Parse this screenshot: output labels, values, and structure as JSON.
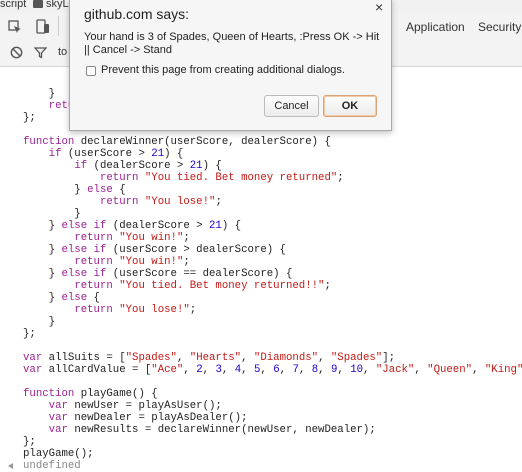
{
  "top": {
    "breadcrumb_left": "script",
    "breadcrumb_right": "skyLa"
  },
  "tabs": {
    "application": "Application",
    "security": "Security"
  },
  "filter": {
    "partial_label": "to"
  },
  "dialog": {
    "title": "github.com says:",
    "message": "Your hand is 3 of Spades, Queen of Hearts, :Press OK -> Hit || Cancel -> Stand",
    "checkbox_label": "Prevent this page from creating additional dialogs.",
    "cancel_label": "Cancel",
    "ok_label": "OK",
    "close_glyph": "×"
  },
  "console": {
    "lines": [
      [
        {
          "t": "    }",
          "c": "plain"
        }
      ],
      [
        {
          "t": "    retu",
          "c": "kw"
        }
      ],
      [
        {
          "t": "};",
          "c": "plain"
        }
      ],
      [
        {
          "t": "",
          "c": "plain"
        }
      ],
      [
        {
          "t": "function",
          "c": "kw"
        },
        {
          "t": " declareWinner(userScore, dealerScore) {",
          "c": "plain"
        }
      ],
      [
        {
          "t": "    ",
          "c": "plain"
        },
        {
          "t": "if",
          "c": "kw"
        },
        {
          "t": " (userScore > ",
          "c": "plain"
        },
        {
          "t": "21",
          "c": "num"
        },
        {
          "t": ") {",
          "c": "plain"
        }
      ],
      [
        {
          "t": "        ",
          "c": "plain"
        },
        {
          "t": "if",
          "c": "kw"
        },
        {
          "t": " (dealerScore > ",
          "c": "plain"
        },
        {
          "t": "21",
          "c": "num"
        },
        {
          "t": ") {",
          "c": "plain"
        }
      ],
      [
        {
          "t": "            ",
          "c": "plain"
        },
        {
          "t": "return",
          "c": "kw"
        },
        {
          "t": " ",
          "c": "plain"
        },
        {
          "t": "\"You tied. Bet money returned\"",
          "c": "str"
        },
        {
          "t": ";",
          "c": "plain"
        }
      ],
      [
        {
          "t": "        } ",
          "c": "plain"
        },
        {
          "t": "else",
          "c": "kw"
        },
        {
          "t": " {",
          "c": "plain"
        }
      ],
      [
        {
          "t": "            ",
          "c": "plain"
        },
        {
          "t": "return",
          "c": "kw"
        },
        {
          "t": " ",
          "c": "plain"
        },
        {
          "t": "\"You lose!\"",
          "c": "str"
        },
        {
          "t": ";",
          "c": "plain"
        }
      ],
      [
        {
          "t": "        }",
          "c": "plain"
        }
      ],
      [
        {
          "t": "    } ",
          "c": "plain"
        },
        {
          "t": "else if",
          "c": "kw"
        },
        {
          "t": " (dealerScore > ",
          "c": "plain"
        },
        {
          "t": "21",
          "c": "num"
        },
        {
          "t": ") {",
          "c": "plain"
        }
      ],
      [
        {
          "t": "        ",
          "c": "plain"
        },
        {
          "t": "return",
          "c": "kw"
        },
        {
          "t": " ",
          "c": "plain"
        },
        {
          "t": "\"You win!\"",
          "c": "str"
        },
        {
          "t": ";",
          "c": "plain"
        }
      ],
      [
        {
          "t": "    } ",
          "c": "plain"
        },
        {
          "t": "else if",
          "c": "kw"
        },
        {
          "t": " (userScore > dealerScore) {",
          "c": "plain"
        }
      ],
      [
        {
          "t": "        ",
          "c": "plain"
        },
        {
          "t": "return",
          "c": "kw"
        },
        {
          "t": " ",
          "c": "plain"
        },
        {
          "t": "\"You win!\"",
          "c": "str"
        },
        {
          "t": ";",
          "c": "plain"
        }
      ],
      [
        {
          "t": "    } ",
          "c": "plain"
        },
        {
          "t": "else if",
          "c": "kw"
        },
        {
          "t": " (userScore == dealerScore) {",
          "c": "plain"
        }
      ],
      [
        {
          "t": "        ",
          "c": "plain"
        },
        {
          "t": "return",
          "c": "kw"
        },
        {
          "t": " ",
          "c": "plain"
        },
        {
          "t": "\"You tied. Bet money returned!!\"",
          "c": "str"
        },
        {
          "t": ";",
          "c": "plain"
        }
      ],
      [
        {
          "t": "    } ",
          "c": "plain"
        },
        {
          "t": "else",
          "c": "kw"
        },
        {
          "t": " {",
          "c": "plain"
        }
      ],
      [
        {
          "t": "        ",
          "c": "plain"
        },
        {
          "t": "return",
          "c": "kw"
        },
        {
          "t": " ",
          "c": "plain"
        },
        {
          "t": "\"You lose!\"",
          "c": "str"
        },
        {
          "t": ";",
          "c": "plain"
        }
      ],
      [
        {
          "t": "    }",
          "c": "plain"
        }
      ],
      [
        {
          "t": "};",
          "c": "plain"
        }
      ],
      [
        {
          "t": "",
          "c": "plain"
        }
      ],
      [
        {
          "t": "var",
          "c": "kw"
        },
        {
          "t": " allSuits = [",
          "c": "plain"
        },
        {
          "t": "\"Spades\"",
          "c": "str"
        },
        {
          "t": ", ",
          "c": "plain"
        },
        {
          "t": "\"Hearts\"",
          "c": "str"
        },
        {
          "t": ", ",
          "c": "plain"
        },
        {
          "t": "\"Diamonds\"",
          "c": "str"
        },
        {
          "t": ", ",
          "c": "plain"
        },
        {
          "t": "\"Spades\"",
          "c": "str"
        },
        {
          "t": "];",
          "c": "plain"
        }
      ],
      [
        {
          "t": "var",
          "c": "kw"
        },
        {
          "t": " allCardValue = [",
          "c": "plain"
        },
        {
          "t": "\"Ace\"",
          "c": "str"
        },
        {
          "t": ", ",
          "c": "plain"
        },
        {
          "t": "2",
          "c": "num"
        },
        {
          "t": ", ",
          "c": "plain"
        },
        {
          "t": "3",
          "c": "num"
        },
        {
          "t": ", ",
          "c": "plain"
        },
        {
          "t": "4",
          "c": "num"
        },
        {
          "t": ", ",
          "c": "plain"
        },
        {
          "t": "5",
          "c": "num"
        },
        {
          "t": ", ",
          "c": "plain"
        },
        {
          "t": "6",
          "c": "num"
        },
        {
          "t": ", ",
          "c": "plain"
        },
        {
          "t": "7",
          "c": "num"
        },
        {
          "t": ", ",
          "c": "plain"
        },
        {
          "t": "8",
          "c": "num"
        },
        {
          "t": ", ",
          "c": "plain"
        },
        {
          "t": "9",
          "c": "num"
        },
        {
          "t": ", ",
          "c": "plain"
        },
        {
          "t": "10",
          "c": "num"
        },
        {
          "t": ", ",
          "c": "plain"
        },
        {
          "t": "\"Jack\"",
          "c": "str"
        },
        {
          "t": ", ",
          "c": "plain"
        },
        {
          "t": "\"Queen\"",
          "c": "str"
        },
        {
          "t": ", ",
          "c": "plain"
        },
        {
          "t": "\"King\"",
          "c": "str"
        },
        {
          "t": "];",
          "c": "plain"
        }
      ],
      [
        {
          "t": "",
          "c": "plain"
        }
      ],
      [
        {
          "t": "function",
          "c": "kw"
        },
        {
          "t": " playGame() {",
          "c": "plain"
        }
      ],
      [
        {
          "t": "    ",
          "c": "plain"
        },
        {
          "t": "var",
          "c": "kw"
        },
        {
          "t": " newUser = playAsUser();",
          "c": "plain"
        }
      ],
      [
        {
          "t": "    ",
          "c": "plain"
        },
        {
          "t": "var",
          "c": "kw"
        },
        {
          "t": " newDealer = playAsDealer();",
          "c": "plain"
        }
      ],
      [
        {
          "t": "    ",
          "c": "plain"
        },
        {
          "t": "var",
          "c": "kw"
        },
        {
          "t": " newResults = declareWinner(newUser, newDealer);",
          "c": "plain"
        }
      ],
      [
        {
          "t": "};",
          "c": "plain"
        }
      ],
      [
        {
          "t": "playGame();",
          "c": "plain"
        }
      ],
      [
        {
          "t": "undefined",
          "c": "out"
        }
      ]
    ]
  },
  "icons": {
    "inspect": "inspect-element-icon",
    "device": "device-toolbar-icon",
    "clear": "clear-console-icon",
    "filter": "filter-icon",
    "folder": "folder-icon"
  }
}
